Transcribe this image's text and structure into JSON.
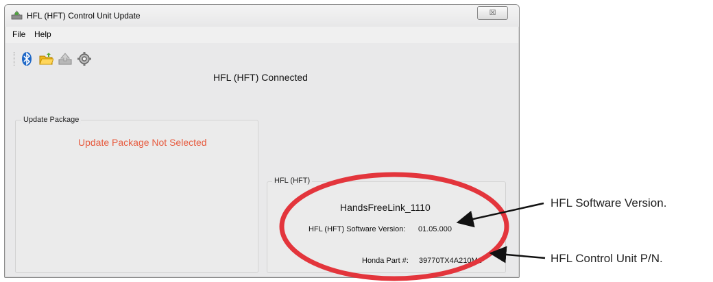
{
  "window": {
    "title": "HFL (HFT) Control Unit Update",
    "close_glyph": "☒"
  },
  "menu": {
    "items": [
      {
        "label": "File"
      },
      {
        "label": "Help"
      }
    ]
  },
  "toolbar": {
    "icons": [
      "bluetooth-icon",
      "open-folder-icon",
      "upload-icon",
      "settings-gear-icon"
    ]
  },
  "status": {
    "connection": "HFL (HFT) Connected"
  },
  "update_package": {
    "group_label": "Update Package",
    "status": "Update Package Not Selected",
    "status_color": "#e75b3f"
  },
  "hfl": {
    "group_label": "HFL (HFT)",
    "device_name": "HandsFreeLink_1110",
    "software_version_label": "HFL (HFT) Software Version:",
    "software_version_value": "01.05.000",
    "part_number_label": "Honda Part #:",
    "part_number_value": "39770TX4A210M1"
  },
  "annotations": {
    "software_version": "HFL Software Version.",
    "control_unit_pn": "HFL Control Unit P/N.",
    "highlight_color": "#e3353c"
  }
}
